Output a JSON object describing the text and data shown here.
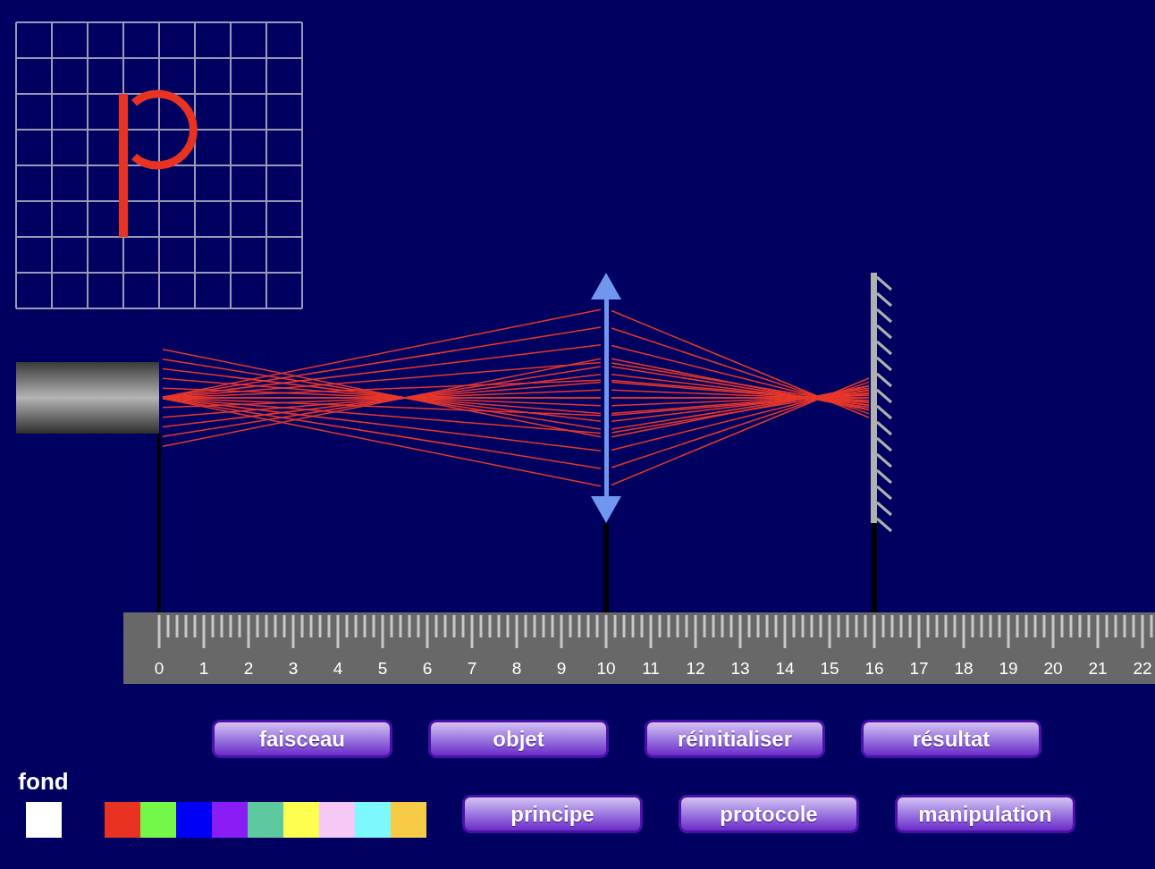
{
  "ruler": {
    "labels": [
      "0",
      "1",
      "2",
      "3",
      "4",
      "5",
      "6",
      "7",
      "8",
      "9",
      "10",
      "11",
      "12",
      "13",
      "14",
      "15",
      "16",
      "17",
      "18",
      "19",
      "20",
      "21",
      "22"
    ]
  },
  "button_rows": [
    [
      "faisceau",
      "objet",
      "réinitialiser",
      "résultat"
    ],
    [
      "principe",
      "protocole",
      "manipulation"
    ]
  ],
  "background": {
    "label": "fond",
    "color": "#ffffff"
  },
  "swatches": [
    {
      "color": "#e83323"
    },
    {
      "color": "#73f84a"
    },
    {
      "color": "#0000f5"
    },
    {
      "color": "#8a1cf5"
    },
    {
      "color": "#5ec89e"
    },
    {
      "color": "#fefe50"
    },
    {
      "color": "#f6c8f6"
    },
    {
      "color": "#7df9fd"
    },
    {
      "color": "#f6cc46"
    }
  ]
}
